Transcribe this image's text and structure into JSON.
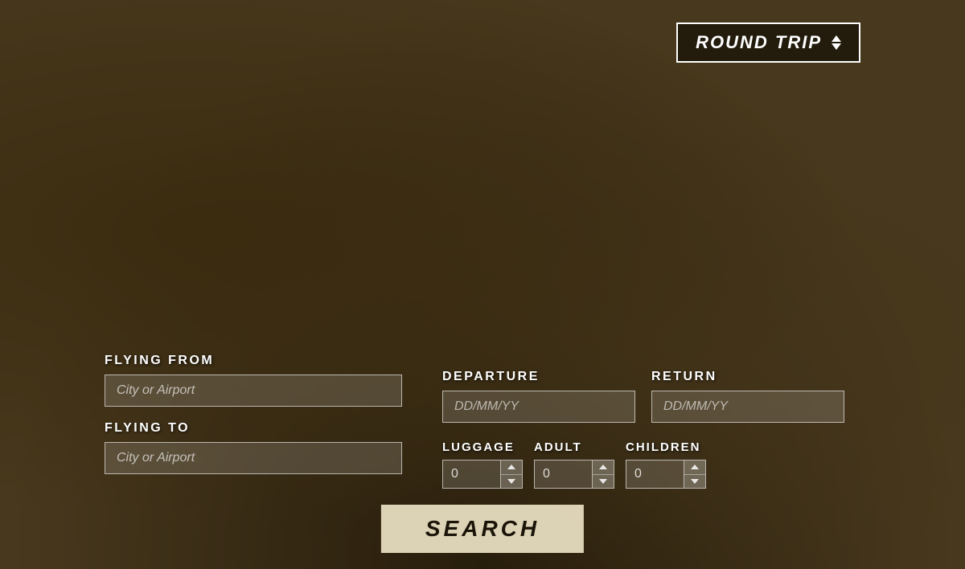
{
  "tripType": {
    "label": "ROUND TRIP",
    "ariaLabel": "trip-type-selector"
  },
  "flyingFrom": {
    "label": "FLYING FROM",
    "placeholder": "City or Airport"
  },
  "flyingTo": {
    "label": "FLYING TO",
    "placeholder": "City or Airport"
  },
  "departure": {
    "label": "DEPARTURE",
    "placeholder": "DD/MM/YY"
  },
  "return": {
    "label": "RETURN",
    "placeholder": "DD/MM/YY"
  },
  "luggage": {
    "label": "LUGGAGE",
    "value": "0"
  },
  "adult": {
    "label": "ADULT",
    "value": "0"
  },
  "children": {
    "label": "CHILDREN",
    "value": "0"
  },
  "search": {
    "label": "SEARCH"
  }
}
